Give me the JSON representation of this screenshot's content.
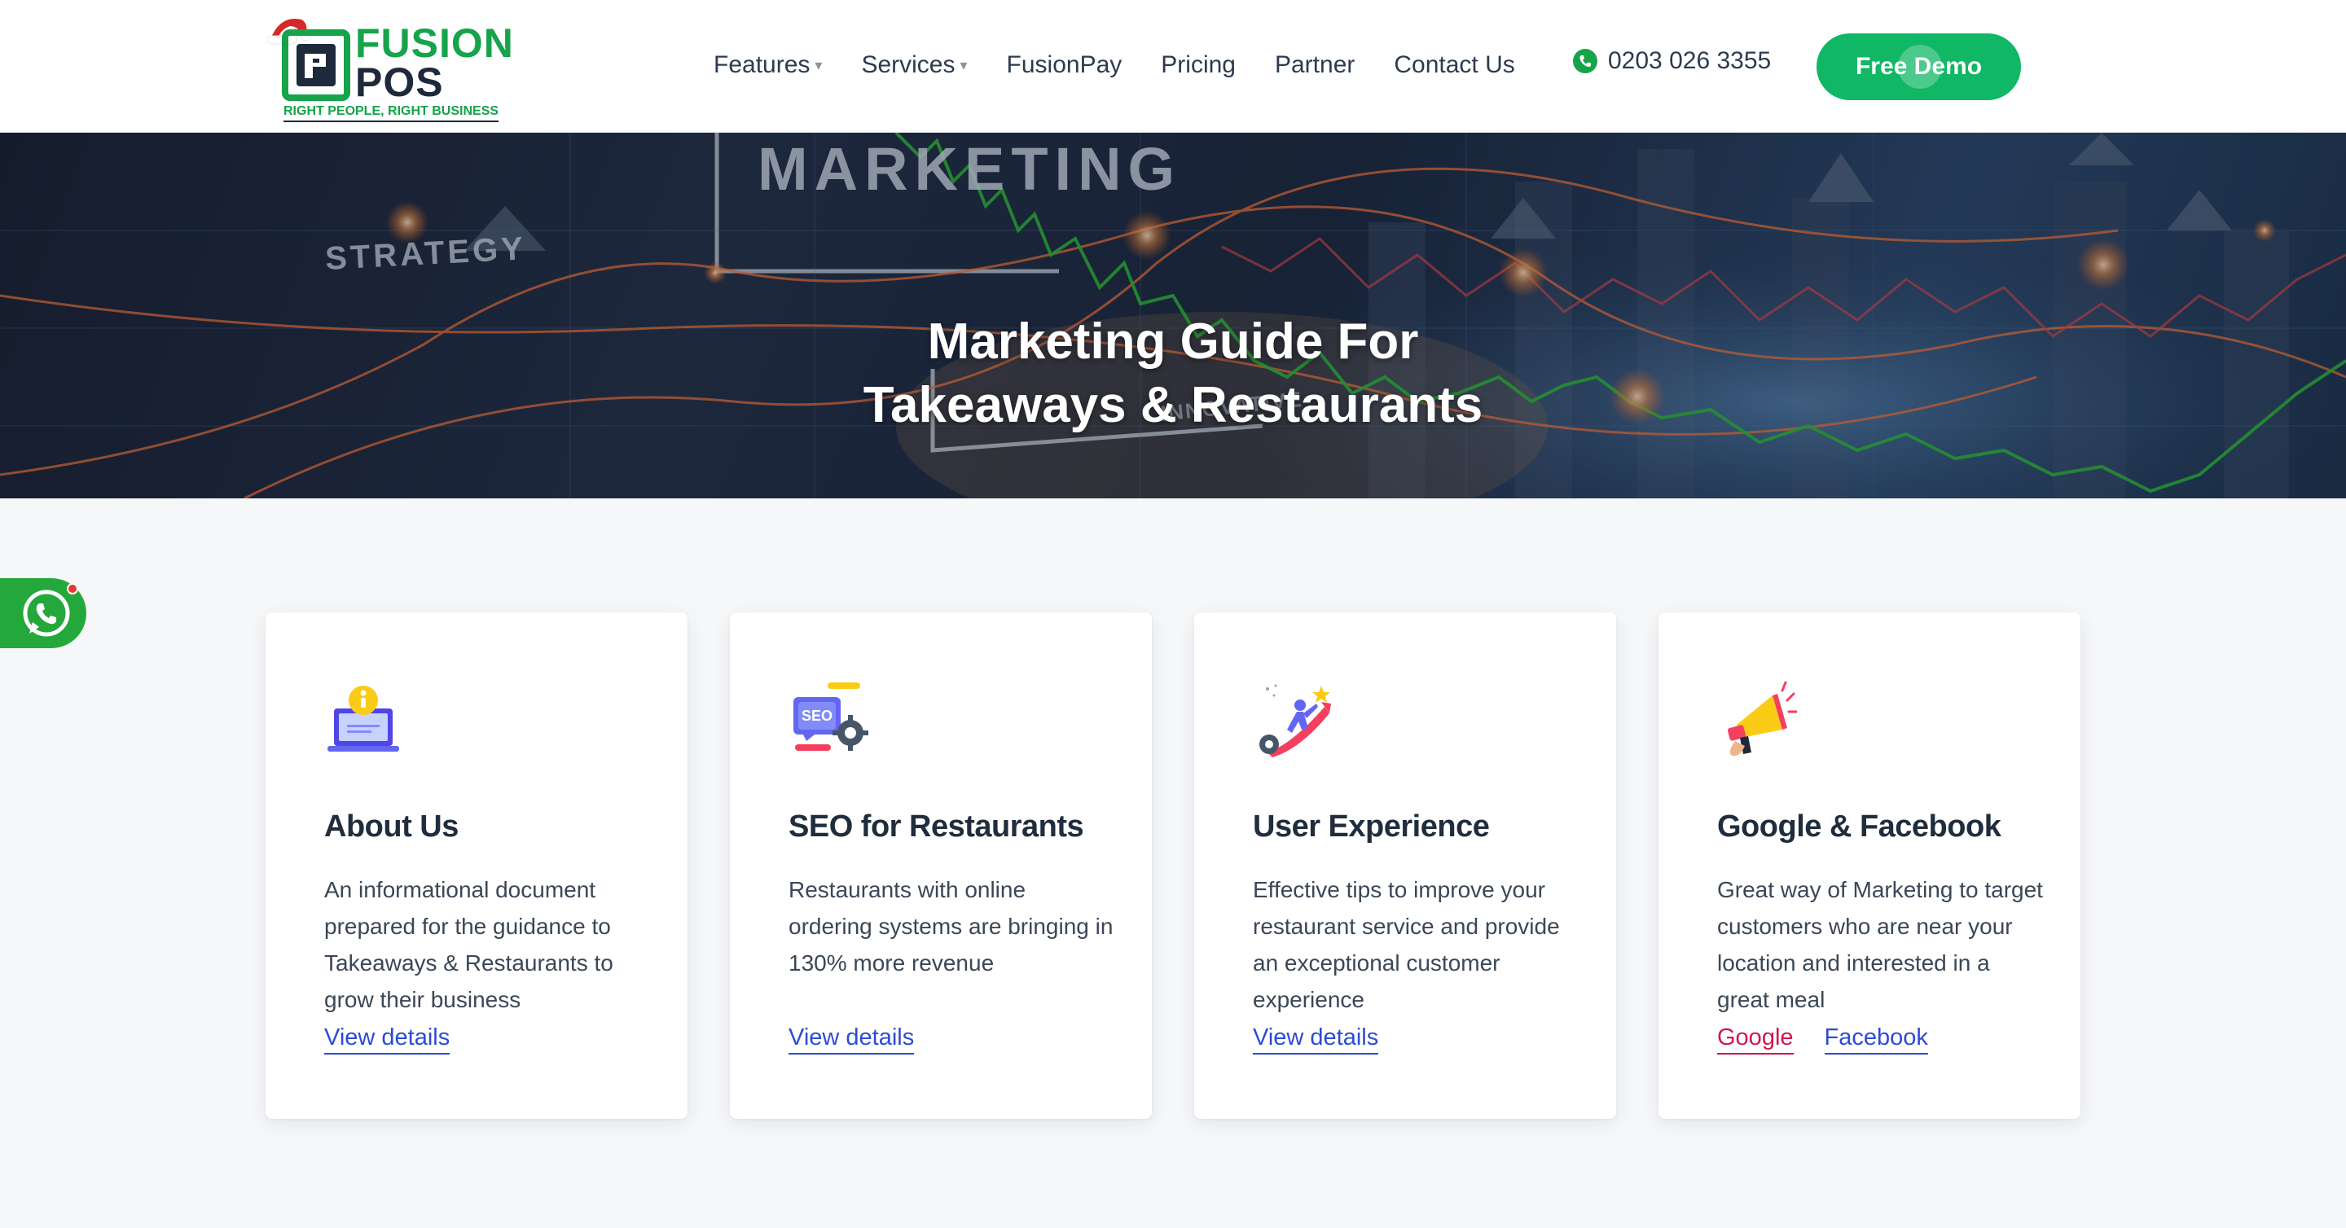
{
  "brand": {
    "name_line1": "FUSION",
    "name_line2": "POS",
    "tagline": "RIGHT PEOPLE, RIGHT BUSINESS",
    "primary_color": "#16a34a",
    "dark_color": "#1e293b"
  },
  "nav": {
    "items": [
      {
        "label": "Features",
        "dropdown": true
      },
      {
        "label": "Services",
        "dropdown": true
      },
      {
        "label": "FusionPay",
        "dropdown": false
      },
      {
        "label": "Pricing",
        "dropdown": false
      },
      {
        "label": "Partner",
        "dropdown": false
      },
      {
        "label": "Contact Us",
        "dropdown": false
      }
    ],
    "caret": "▾",
    "phone": "0203 026 3355",
    "phone_icon": "phone-icon",
    "cta_label": "Free Demo",
    "cta_color": "#10b765"
  },
  "hero": {
    "title_line1": "Marketing Guide For",
    "title_line2": "Takeaways & Restaurants",
    "background_words": [
      "MARKETING",
      "STRATEGY",
      "INNOVATIVE"
    ]
  },
  "whatsapp": {
    "icon": "whatsapp-icon",
    "color": "#25a83b"
  },
  "cards": [
    {
      "icon": "info-laptop-icon",
      "title": "About Us",
      "description": "An informational document prepared for the guidance to Takeaways & Restaurants to grow their business",
      "links": [
        "View details"
      ]
    },
    {
      "icon": "seo-gear-icon",
      "title": "SEO for Restaurants",
      "description": "Restaurants with online ordering systems are bringing in 130% more revenue",
      "links": [
        "View details"
      ]
    },
    {
      "icon": "growth-climb-icon",
      "title": "User Experience",
      "description": "Effective tips to improve your restaurant service and provide an exceptional customer experience",
      "links": [
        "View details"
      ]
    },
    {
      "icon": "megaphone-icon",
      "title": "Google & Facebook",
      "description": "Great way of Marketing to target customers who are near your location and interested in a great meal",
      "links": [
        "Google",
        "Facebook"
      ]
    }
  ],
  "link_color": "#2d4bd6",
  "google_link_color": "#d0174e"
}
